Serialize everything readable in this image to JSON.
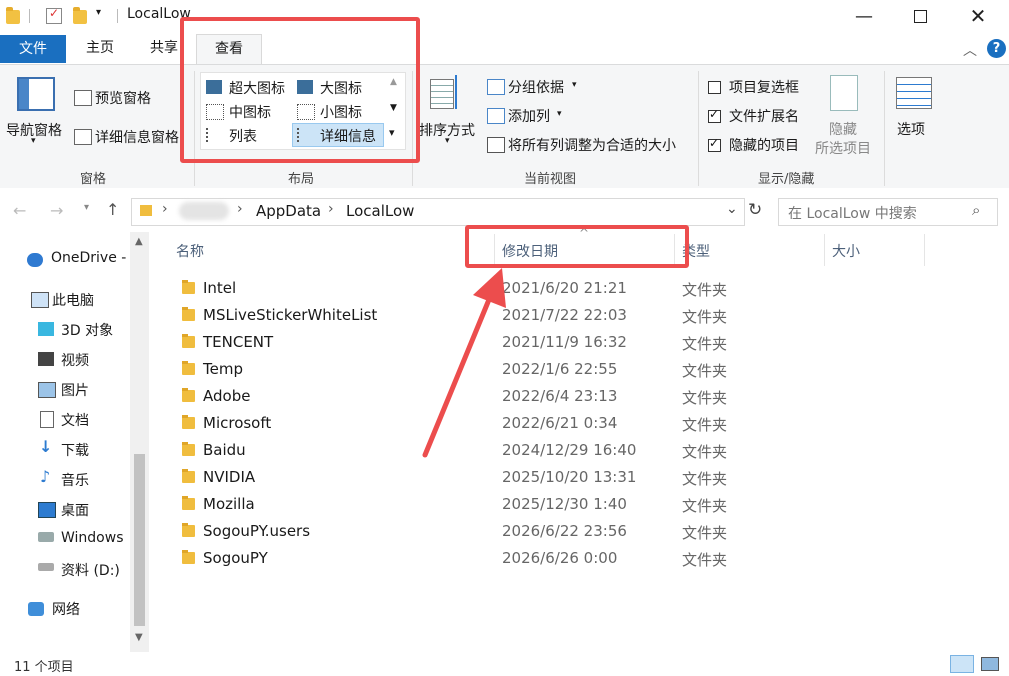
{
  "window": {
    "title": "LocalLow"
  },
  "tabs": {
    "file": "文件",
    "home": "主页",
    "share": "共享",
    "view": "查看"
  },
  "ribbon": {
    "pane": {
      "nav_pane": "导航窗格",
      "preview_pane": "预览窗格",
      "details_pane": "详细信息窗格",
      "group": "窗格"
    },
    "layout": {
      "extra_large": "超大图标",
      "large": "大图标",
      "medium": "中图标",
      "small": "小图标",
      "list": "列表",
      "details": "详细信息",
      "group": "布局"
    },
    "current_view": {
      "sort_by": "排序方式",
      "group_by": "分组依据",
      "add_columns": "添加列",
      "size_all": "将所有列调整为合适的大小",
      "group": "当前视图"
    },
    "show_hide": {
      "item_checkboxes": "项目复选框",
      "file_extensions": "文件扩展名",
      "hidden_items": "隐藏的项目",
      "hide_selected_1": "隐藏",
      "hide_selected_2": "所选项目",
      "options": "选项",
      "group": "显示/隐藏"
    }
  },
  "address": {
    "crumb1": "AppData",
    "crumb2": "LocalLow",
    "search_placeholder": "在 LocalLow 中搜索"
  },
  "nav": {
    "onedrive": "OneDrive -",
    "this_pc": "此电脑",
    "objects3d": "3D 对象",
    "videos": "视频",
    "pictures": "图片",
    "documents": "文档",
    "downloads": "下载",
    "music": "音乐",
    "desktop": "桌面",
    "windows": "Windows",
    "data_d": "资料 (D:)",
    "network": "网络"
  },
  "columns": {
    "name": "名称",
    "date": "修改日期",
    "type": "类型",
    "size": "大小"
  },
  "files": [
    {
      "name": "Intel",
      "date": "2021/6/20 21:21",
      "type": "文件夹"
    },
    {
      "name": "MSLiveStickerWhiteList",
      "date": "2021/7/22 22:03",
      "type": "文件夹"
    },
    {
      "name": "TENCENT",
      "date": "2021/11/9 16:32",
      "type": "文件夹"
    },
    {
      "name": "Temp",
      "date": "2022/1/6 22:55",
      "type": "文件夹"
    },
    {
      "name": "Adobe",
      "date": "2022/6/4 23:13",
      "type": "文件夹"
    },
    {
      "name": "Microsoft",
      "date": "2022/6/21 0:34",
      "type": "文件夹"
    },
    {
      "name": "Baidu",
      "date": "2024/12/29 16:40",
      "type": "文件夹"
    },
    {
      "name": "NVIDIA",
      "date": "2025/10/20 13:31",
      "type": "文件夹"
    },
    {
      "name": "Mozilla",
      "date": "2025/12/30 1:40",
      "type": "文件夹"
    },
    {
      "name": "SogouPY.users",
      "date": "2026/6/22 23:56",
      "type": "文件夹"
    },
    {
      "name": "SogouPY",
      "date": "2026/6/26 0:00",
      "type": "文件夹"
    }
  ],
  "status": {
    "count": "11 个项目"
  },
  "colors": {
    "accent": "#1a6fc0",
    "annotation": "#ec4d4d",
    "folder": "#f0bd3e"
  }
}
